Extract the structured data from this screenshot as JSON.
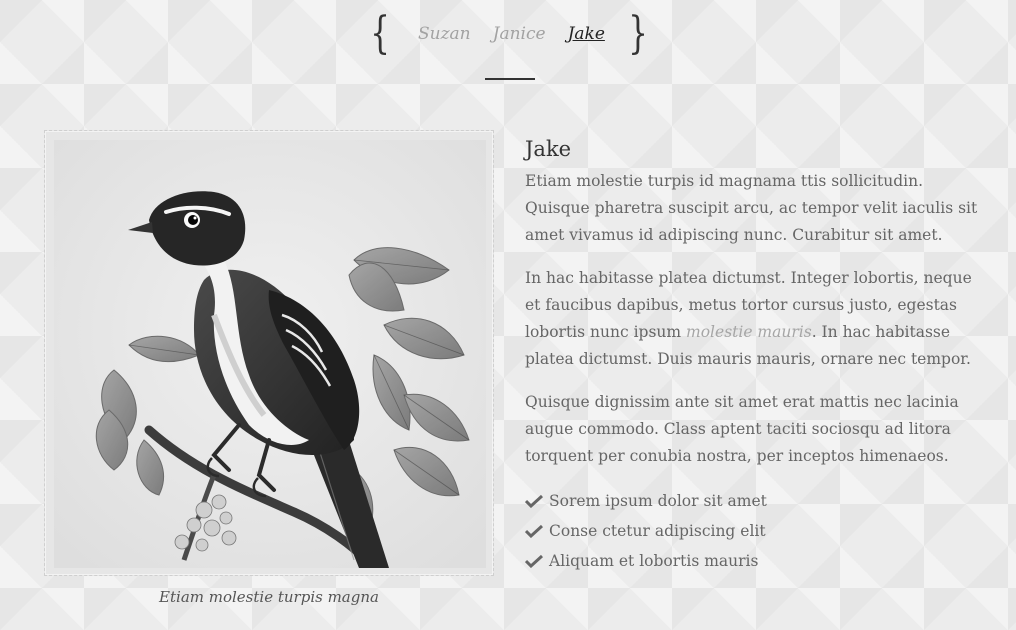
{
  "nav": {
    "links": [
      {
        "label": "Suzan",
        "active": false
      },
      {
        "label": "Janice",
        "active": false
      },
      {
        "label": "Jake",
        "active": true
      }
    ],
    "brace_left": "{",
    "brace_right": "}"
  },
  "figure": {
    "image_icon": "bird-illustration",
    "caption": "Etiam molestie turpis magna"
  },
  "profile": {
    "name": "Jake",
    "para1": "Etiam molestie turpis id magnama ttis sollicitudin. Quisque pharetra suscipit arcu, ac tempor velit iaculis sit amet vivamus id adipiscing nunc. Curabitur sit amet.",
    "para2_before": "In hac habitasse platea dictumst. Integer lobortis, neque et faucibus dapibus, metus tortor cursus justo, egestas lobortis nunc ipsum ",
    "para2_link": "molestie mauris",
    "para2_after": ". In hac habitasse platea dictumst. Duis mauris mauris, ornare nec tempor.",
    "para3": "Quisque dignissim ante sit amet erat mattis nec lacinia augue commodo. Class aptent taciti sociosqu ad litora torquent per conubia nostra, per inceptos himenaeos.",
    "checklist": [
      "Sorem ipsum dolor sit amet",
      "Conse ctetur adipiscing elit",
      "Aliquam et lobortis mauris"
    ]
  },
  "colors": {
    "background": "#ececec",
    "text": "#666666",
    "heading": "#333333",
    "muted_link": "#a2a2a2",
    "active_link": "#222222"
  }
}
